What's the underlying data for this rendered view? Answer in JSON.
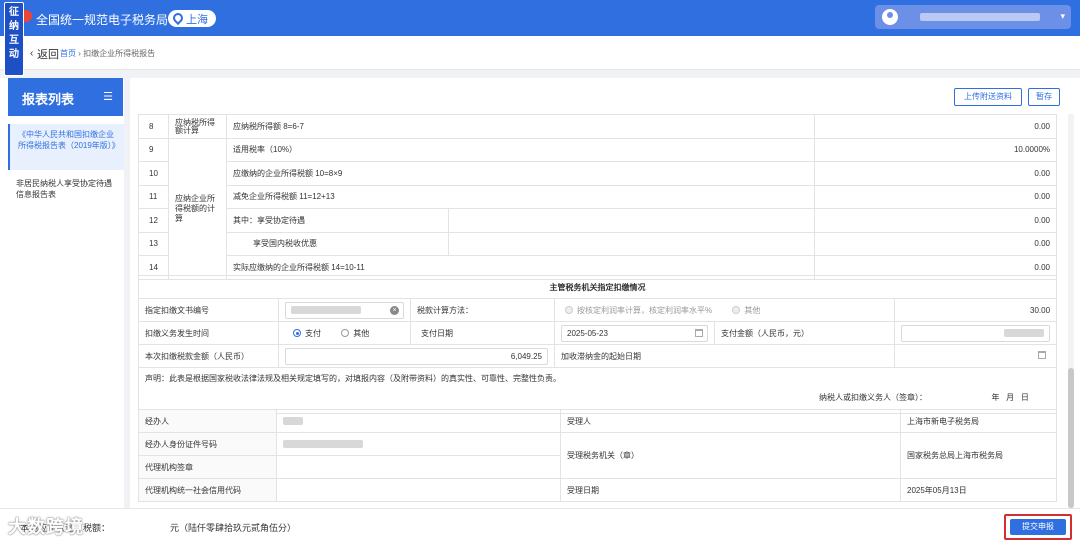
{
  "header": {
    "badge": [
      "征",
      "纳",
      "互",
      "动"
    ],
    "site_title": "全国统一规范电子税务局",
    "region": "上海"
  },
  "breadcrumb": {
    "back": "返回",
    "home": "首页",
    "separator": "›",
    "current": "扣缴企业所得税报告"
  },
  "sidebar": {
    "title": "报表列表",
    "items": [
      "《中华人民共和国扣缴企业所得税报告表（2019年版）》",
      "非居民纳税人享受协定待遇信息报告表"
    ]
  },
  "toolbar": {
    "upload_label": "上传附送资料",
    "save_label": "暂存"
  },
  "calc_rows": {
    "group_a_partial": "应纳税所得额计算",
    "group_b": "应纳企业所得税额的计算",
    "rows": [
      {
        "no": "8",
        "label": "应纳税所得额  8=6-7",
        "value": "0.00"
      },
      {
        "no": "9",
        "label": "适用税率（10%）",
        "value": "10.0000%"
      },
      {
        "no": "10",
        "label": "应缴纳的企业所得税额  10=8×9",
        "value": "0.00"
      },
      {
        "no": "11",
        "label": "减免企业所得税额  11=12+13",
        "value": "0.00"
      },
      {
        "no": "12",
        "label": "其中：享受协定待遇",
        "value": "0.00"
      },
      {
        "no": "13",
        "label": "享受国内税收优惠",
        "value": "0.00"
      },
      {
        "no": "14",
        "label": "实际应缴纳的企业所得税额  14=10-11",
        "value": "0.00"
      }
    ]
  },
  "designation": {
    "section_title": "主管税务机关指定扣缴情况",
    "doc_no_label": "指定扣缴文书编号",
    "calc_method_label": "税款计算方法：",
    "calc_method_opt1": "按核定利润率计算，核定利润率水平%",
    "calc_method_opt2": "其他",
    "rate_value": "30.00",
    "occur_time_label": "扣缴义务发生时间",
    "occur_opt1": "支付",
    "occur_opt2": "其他",
    "pay_date_label": "支付日期",
    "pay_date_value": "2025-05-23",
    "pay_amount_label": "支付金额（人民币，元）",
    "tax_amount_label": "本次扣缴税款金额（人民币）",
    "tax_amount_value": "6,049.25",
    "late_fee_label": "加收滞纳金的起始日期"
  },
  "declaration": {
    "text": "声明：此表是根据国家税收法律法规及相关规定填写的，对填报内容（及附带资料）的真实性、可靠性、完整性负责。",
    "signer": "纳税人或扣缴义务人（签章）：",
    "year": "年",
    "month": "月",
    "day": "日"
  },
  "handler": {
    "agent_label": "经办人",
    "agent_id_label": "经办人身份证件号码",
    "agency_seal_label": "代理机构签章",
    "agency_code_label": "代理机构统一社会信用代码",
    "receiver_label": "受理人",
    "receiver_value": "上海市新电子税务局",
    "authority_label": "受理税务机关（章）",
    "authority_value": "国家税务总局上海市税务局",
    "date_label": "受理日期",
    "date_value": "2025年05月13日"
  },
  "footer": {
    "amount_text": "本期应补（退）税额：",
    "amount_suffix": "元（陆仟零肆拾玖元贰角伍分）",
    "watermark": "大数跨境",
    "submit_label": "提交申报"
  }
}
